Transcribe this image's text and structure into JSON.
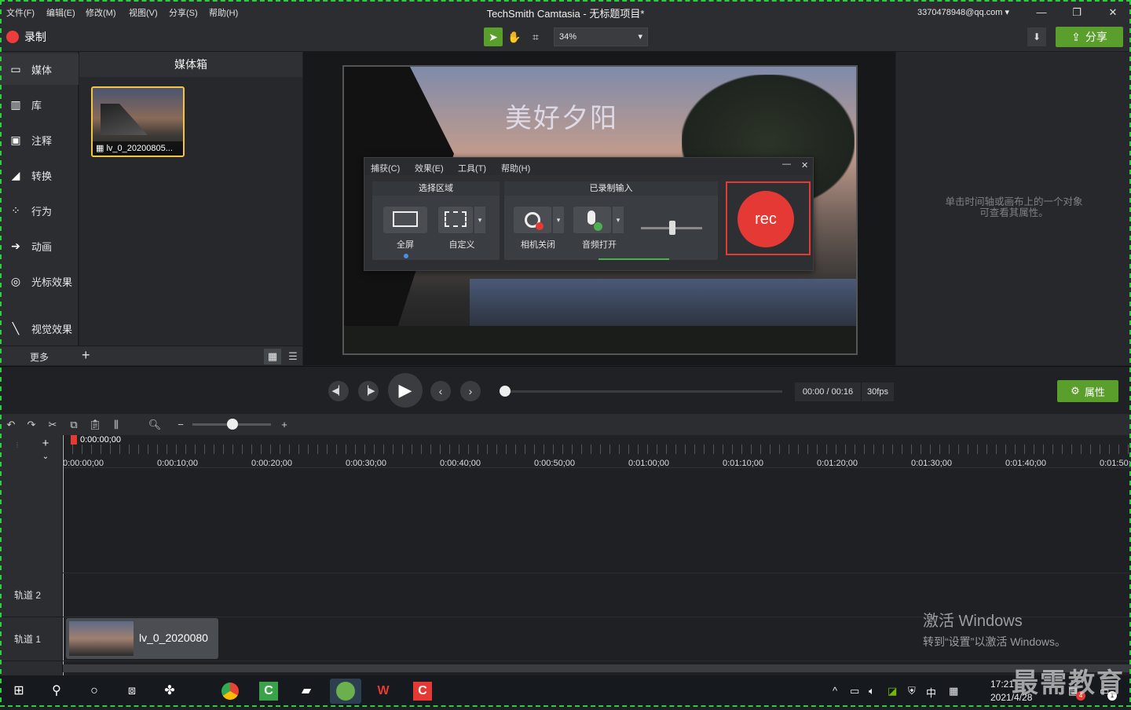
{
  "menubar": {
    "items": [
      "文件(F)",
      "编辑(E)",
      "修改(M)",
      "视图(V)",
      "分享(S)",
      "帮助(H)"
    ],
    "title": "TechSmith Camtasia - 无标题项目*",
    "account": "3370478948@qq.com"
  },
  "toolbar": {
    "record_label": "录制",
    "zoom": "34%",
    "share_label": "分享"
  },
  "sidebar": {
    "items": [
      {
        "label": "媒体",
        "icon": "media-icon"
      },
      {
        "label": "库",
        "icon": "library-icon"
      },
      {
        "label": "注释",
        "icon": "annotation-icon"
      },
      {
        "label": "转换",
        "icon": "transition-icon"
      },
      {
        "label": "行为",
        "icon": "behavior-icon"
      },
      {
        "label": "动画",
        "icon": "animation-icon"
      },
      {
        "label": "光标效果",
        "icon": "cursor-effect-icon"
      },
      {
        "label": "视觉效果",
        "icon": "visual-effect-icon"
      }
    ],
    "more_label": "更多"
  },
  "bin": {
    "title": "媒体箱",
    "clip_name": "lv_0_20200805..."
  },
  "canvas": {
    "caption": "美好夕阳"
  },
  "recorder": {
    "menu": [
      "捕获(C)",
      "效果(E)",
      "工具(T)",
      "帮助(H)"
    ],
    "area_title": "选择区域",
    "fullscreen_label": "全屏",
    "custom_label": "自定义",
    "inputs_title": "已录制输入",
    "camera_label": "相机关闭",
    "audio_label": "音频打开",
    "rec_label": "rec"
  },
  "properties": {
    "hint_line1": "单击时间轴或画布上的一个对象",
    "hint_line2": "可查看其属性。"
  },
  "player": {
    "timecode": "00:00 / 00:16",
    "fps": "30fps",
    "properties_label": "属性",
    "progress": 0
  },
  "timeline": {
    "playhead": "0:00:00;00",
    "ticks": [
      "0:00:00;00",
      "0:00:10;00",
      "0:00:20;00",
      "0:00:30;00",
      "0:00:40;00",
      "0:00:50;00",
      "0:01:00;00",
      "0:01:10;00",
      "0:01:20;00",
      "0:01:30;00",
      "0:01:40;00",
      "0:01:50;"
    ],
    "tracks": [
      "轨道 2",
      "轨道 1"
    ],
    "clip_label": "lv_0_2020080"
  },
  "activation": {
    "title": "激活 Windows",
    "subtitle": "转到“设置”以激活 Windows。"
  },
  "watermark": "最需教育",
  "taskbar": {
    "ime": "中",
    "time": "17:21",
    "date": "2021/4/28",
    "notification_count": "4",
    "message_count": "1"
  },
  "colors": {
    "accent_green": "#5a9e2c",
    "record_red": "#e53935",
    "selection_yellow": "#f5c542"
  }
}
